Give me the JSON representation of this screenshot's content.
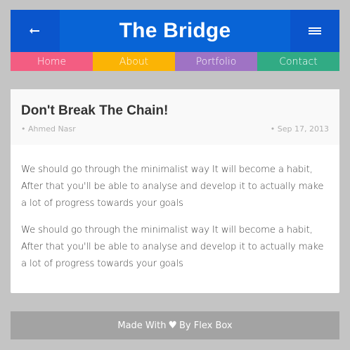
{
  "header": {
    "title": "The Bridge",
    "back_icon": "back-arrow-icon",
    "menu_icon": "hamburger-menu-icon",
    "colors": {
      "side_buttons": "#0a55cc",
      "title_bg": "#0864d6"
    }
  },
  "nav": {
    "items": [
      {
        "label": "Home",
        "color": "#f35d82"
      },
      {
        "label": "About",
        "color": "#fbb405"
      },
      {
        "label": "Portfolio",
        "color": "#9f73c4"
      },
      {
        "label": "Contact",
        "color": "#31ab84"
      }
    ]
  },
  "post": {
    "title": "Don't Break The Chain!",
    "author": "• Ahmed Nasr",
    "date": "• Sep 17, 2013",
    "paragraphs": [
      "We should go through the minimalist way It will become a habit, After that you'll be able to analyse and develop it to actually make a lot of progress towards your goals",
      "We should go through the minimalist way It will become a habit, After that you'll be able to analyse and develop it to actually make a lot of progress towards your goals"
    ]
  },
  "footer": {
    "prefix": "Made With",
    "heart": "♥",
    "suffix": "By Flex Box",
    "heart_icon": "heart-icon"
  }
}
